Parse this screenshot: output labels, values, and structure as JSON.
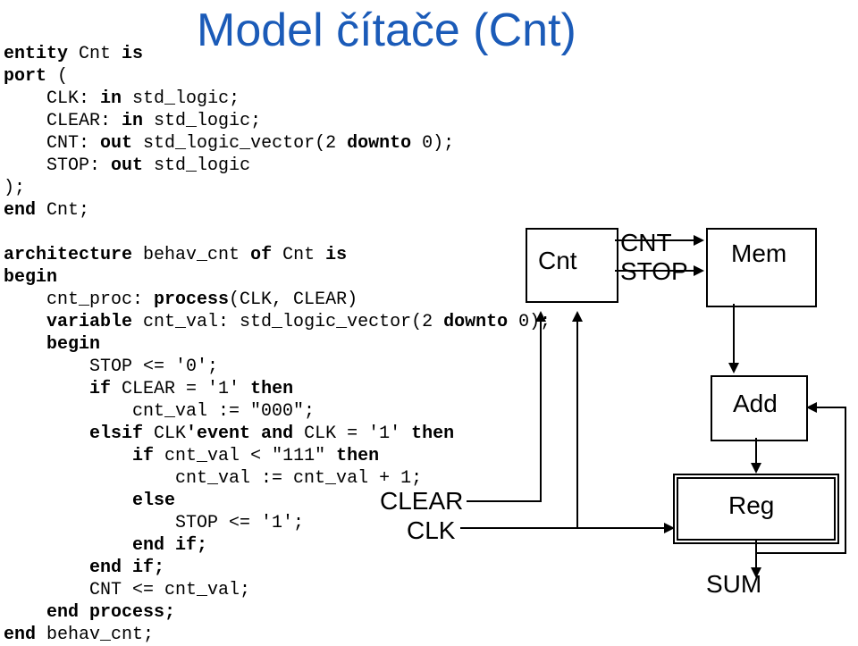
{
  "title": "Model čítače (Cnt)",
  "code": {
    "l1a": "entity",
    "l1b": " Cnt ",
    "l1c": "is",
    "l2a": "port",
    "l2b": " (",
    "l3a": "    CLK: ",
    "l3b": "in",
    "l3c": " std_logic;",
    "l4a": "    CLEAR: ",
    "l4b": "in",
    "l4c": " std_logic;",
    "l5a": "    CNT: ",
    "l5b": "out",
    "l5c": " std_logic_vector(2 ",
    "l5d": "downto",
    "l5e": " 0);",
    "l6a": "    STOP: ",
    "l6b": "out",
    "l6c": " std_logic",
    "l7": ");",
    "l8a": "end",
    "l8b": " Cnt;",
    "l9": "",
    "l10a": "architecture",
    "l10b": " behav_cnt ",
    "l10c": "of",
    "l10d": " Cnt ",
    "l10e": "is",
    "l11": "begin",
    "l12a": "    cnt_proc: ",
    "l12b": "process",
    "l12c": "(CLK, CLEAR)",
    "l13a": "    ",
    "l13b": "variable",
    "l13c": " cnt_val: std_logic_vector(2 ",
    "l13d": "downto",
    "l13e": " 0);",
    "l14a": "    ",
    "l14b": "begin",
    "l15": "        STOP <= '0';",
    "l16a": "        ",
    "l16b": "if",
    "l16c": " CLEAR = '1' ",
    "l16d": "then",
    "l17": "            cnt_val := \"000\";",
    "l18a": "        ",
    "l18b": "elsif",
    "l18c": " CLK",
    "l18d": "'event and",
    "l18e": " CLK = '1' ",
    "l18f": "then",
    "l19a": "            ",
    "l19b": "if",
    "l19c": " cnt_val < \"111\" ",
    "l19d": "then",
    "l20": "                cnt_val := cnt_val + 1;",
    "l21a": "            ",
    "l21b": "else",
    "l22": "                STOP <= '1';",
    "l23a": "            ",
    "l23b": "end if;",
    "l24a": "        ",
    "l24b": "end if;",
    "l25": "        CNT <= cnt_val;",
    "l26a": "    ",
    "l26b": "end process;",
    "l27a": "end",
    "l27b": " behav_cnt;"
  },
  "diagram": {
    "cnt": "Cnt",
    "cnt_port": "CNT",
    "stop_port": "STOP",
    "mem": "Mem",
    "add": "Add",
    "reg": "Reg",
    "sum": "SUM",
    "clear": "CLEAR",
    "clk": "CLK"
  }
}
